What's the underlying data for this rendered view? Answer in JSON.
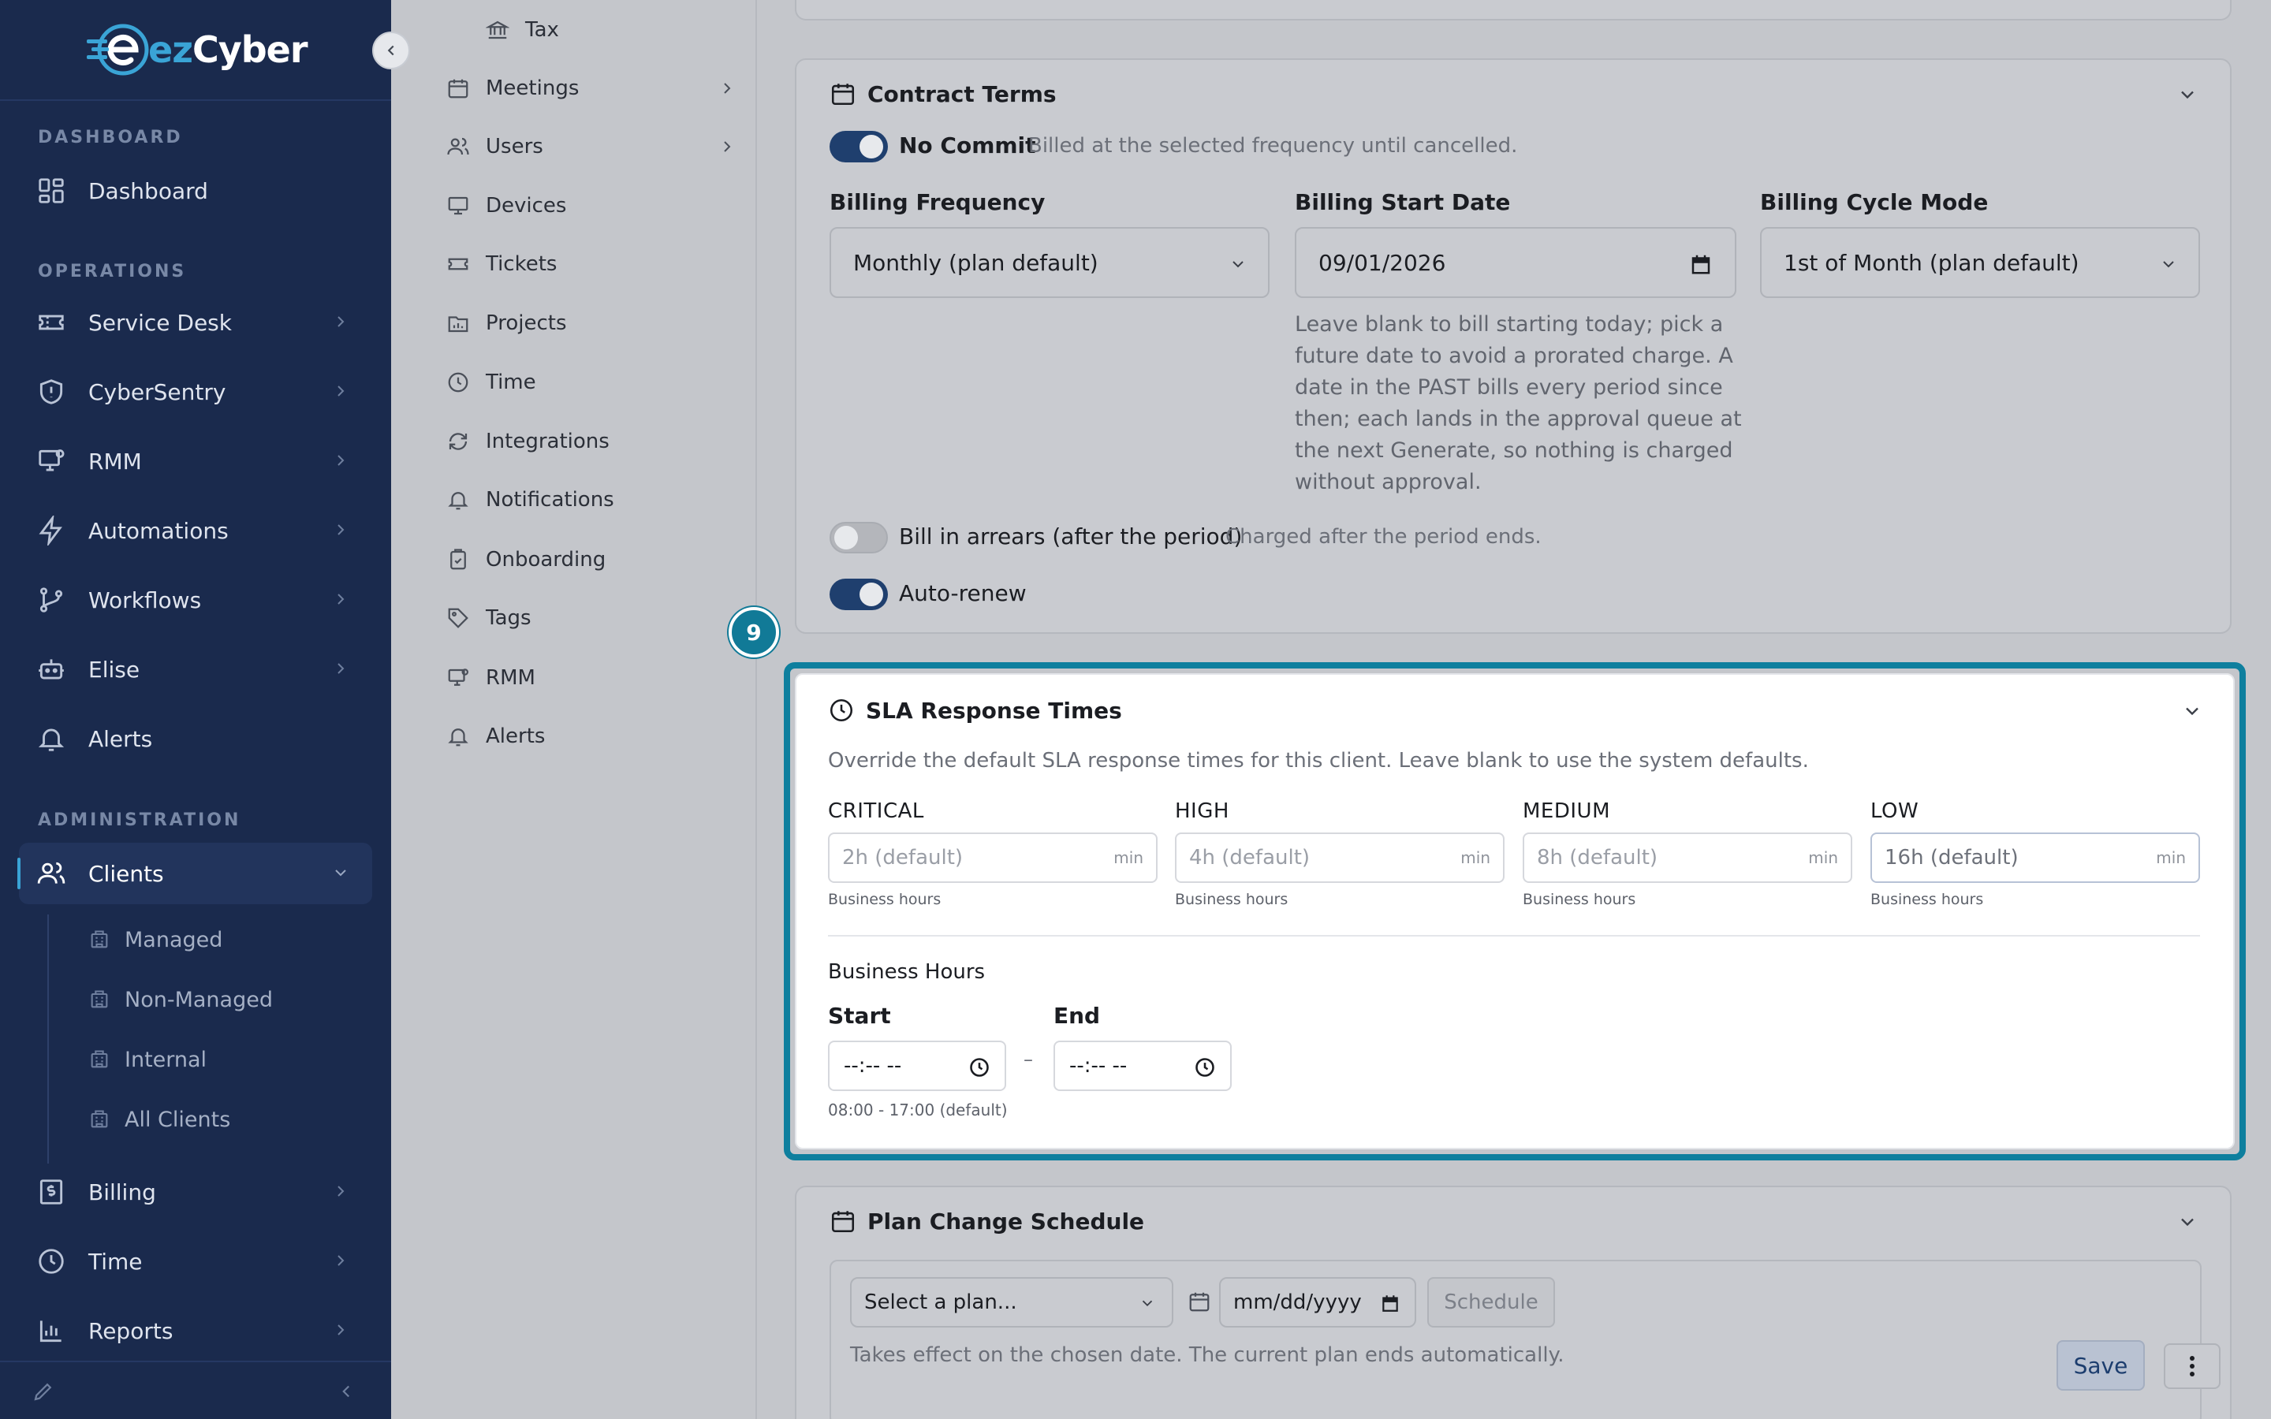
{
  "brand": {
    "name_prefix": "ez",
    "name_suffix": "Cyber",
    "accent": "#3aa4d6",
    "sidebar_bg": "#1a2a4d"
  },
  "sidebar": {
    "sections": [
      "DASHBOARD",
      "OPERATIONS",
      "ADMINISTRATION"
    ],
    "items": [
      {
        "label": "Dashboard",
        "icon": "grid-icon"
      },
      {
        "label": "Service Desk",
        "icon": "ticket-icon"
      },
      {
        "label": "CyberSentry",
        "icon": "shield-icon"
      },
      {
        "label": "RMM",
        "icon": "monitor-icon"
      },
      {
        "label": "Automations",
        "icon": "lightning-icon"
      },
      {
        "label": "Workflows",
        "icon": "branch-icon"
      },
      {
        "label": "Elise",
        "icon": "robot-icon"
      },
      {
        "label": "Alerts",
        "icon": "bell-icon"
      },
      {
        "label": "Clients",
        "icon": "users-icon"
      },
      {
        "label": "Billing",
        "icon": "dollar-icon"
      },
      {
        "label": "Time",
        "icon": "clock-icon"
      },
      {
        "label": "Reports",
        "icon": "chart-icon"
      }
    ],
    "client_subitems": [
      "Managed",
      "Non-Managed",
      "Internal",
      "All Clients"
    ]
  },
  "subnav": {
    "items": [
      "Tax",
      "Meetings",
      "Users",
      "Devices",
      "Tickets",
      "Projects",
      "Time",
      "Integrations",
      "Notifications",
      "Onboarding",
      "Tags",
      "RMM",
      "Alerts"
    ]
  },
  "contract": {
    "title": "Contract Terms",
    "no_commit_label": "No Commit",
    "no_commit_hint": "Billed at the selected frequency until cancelled.",
    "billing_frequency_label": "Billing Frequency",
    "billing_frequency_value": "Monthly (plan default)",
    "billing_start_label": "Billing Start Date",
    "billing_start_value": "09/01/2026",
    "billing_cycle_label": "Billing Cycle Mode",
    "billing_cycle_value": "1st of Month (plan default)",
    "start_help": [
      "Leave blank to bill starting today; pick a",
      "future date to avoid a prorated charge. A",
      "date in the PAST bills every period since",
      "then; each lands in the approval queue at",
      "the next Generate, so nothing is charged",
      "without approval."
    ],
    "arrears_label": "Bill in arrears (after the period)",
    "arrears_hint": "Charged after the period ends.",
    "auto_renew_label": "Auto-renew"
  },
  "step_badge": "9",
  "sla": {
    "title": "SLA Response Times",
    "description": "Override the default SLA response times for this client. Leave blank to use the system defaults.",
    "fields": [
      {
        "label": "CRITICAL",
        "placeholder": "2h (default)",
        "unit": "min",
        "sub": "Business hours"
      },
      {
        "label": "HIGH",
        "placeholder": "4h (default)",
        "unit": "min",
        "sub": "Business hours"
      },
      {
        "label": "MEDIUM",
        "placeholder": "8h (default)",
        "unit": "min",
        "sub": "Business hours"
      },
      {
        "label": "LOW",
        "placeholder": "16h (default)",
        "unit": "min",
        "sub": "Business hours"
      }
    ],
    "business_hours_label": "Business Hours",
    "start_label": "Start",
    "end_label": "End",
    "start_value": "--:-- --",
    "end_value": "--:-- --",
    "separator": "–",
    "default_hint": "08:00 - 17:00 (default)"
  },
  "plan_change": {
    "title": "Plan Change Schedule",
    "select_value": "Select a plan...",
    "date_value": "mm/dd/yyyy",
    "schedule_label": "Schedule",
    "hint": "Takes effect on the chosen date. The current plan ends automatically."
  },
  "actions": {
    "save_label": "Save"
  }
}
